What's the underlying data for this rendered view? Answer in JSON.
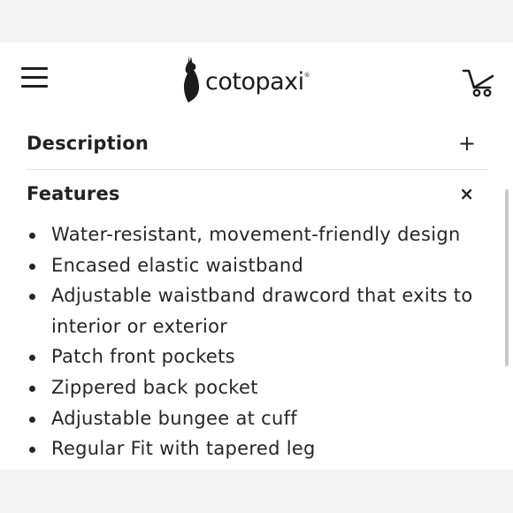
{
  "header": {
    "brand_name": "cotopaxi",
    "brand_mark": "®",
    "menu_icon": "hamburger-menu-icon",
    "cart_icon": "shopping-cart-icon",
    "logo_icon": "llama-logo-icon"
  },
  "sections": [
    {
      "title": "Description",
      "toggle": "+",
      "expanded": false
    },
    {
      "title": "Features",
      "toggle": "×",
      "expanded": true
    }
  ],
  "features": [
    "Water-resistant, movement-friendly design",
    "Encased elastic waistband",
    "Adjustable waistband drawcord that exits to interior or exterior",
    "Patch front pockets",
    "Zippered back pocket",
    "Adjustable bungee at cuff",
    "Regular Fit with tapered leg"
  ],
  "colors": {
    "text": "#222222",
    "background": "#ffffff",
    "divider": "#e3e3e3"
  }
}
